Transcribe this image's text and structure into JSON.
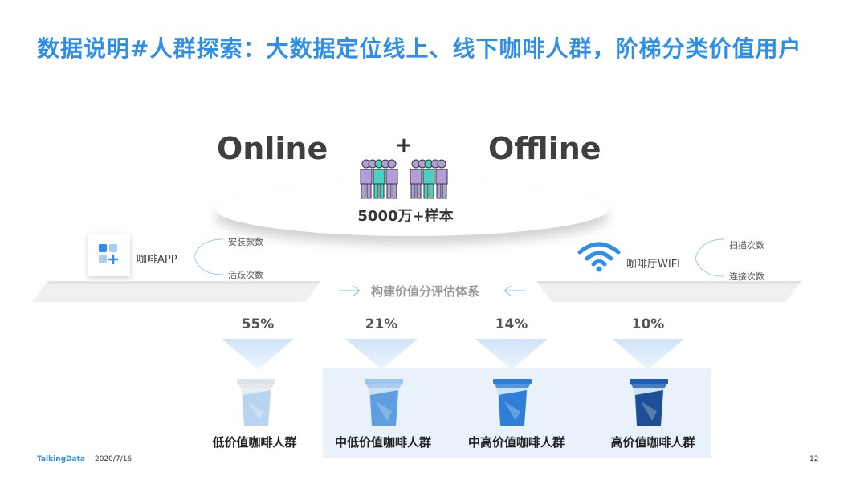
{
  "title": "数据说明#人群探索：大数据定位线上、线下咖啡人群，阶梯分类价值用户",
  "online_label": "Online",
  "offline_label": "Offline",
  "plus_sign": "+",
  "sample_label": "5000万+样本",
  "left_source": {
    "name": "咖啡APP",
    "metric_top": "安装款数",
    "metric_bottom": "活跃次数",
    "icon": "app-grid-icon"
  },
  "right_source": {
    "name": "咖啡厅WIFI",
    "metric_top": "扫描次数",
    "metric_bottom": "连接次数",
    "icon": "wifi-icon"
  },
  "center_label": "构建价值分评估体系",
  "segments": [
    {
      "percent": "55%",
      "label": "低价值咖啡人群",
      "value": 55,
      "fill": 0.35
    },
    {
      "percent": "21%",
      "label": "中低价值咖啡人群",
      "value": 21,
      "fill": 0.5
    },
    {
      "percent": "14%",
      "label": "中高价值咖啡人群",
      "value": 14,
      "fill": 0.65
    },
    {
      "percent": "10%",
      "label": "高价值咖啡人群",
      "value": 10,
      "fill": 0.8
    }
  ],
  "footer": {
    "brand": "TalkingData",
    "date": "2020/7/16",
    "page": "12"
  },
  "colors": {
    "accent": "#2f8ee8",
    "person_purple": "#b39ddb",
    "person_teal": "#4dd0c4"
  }
}
